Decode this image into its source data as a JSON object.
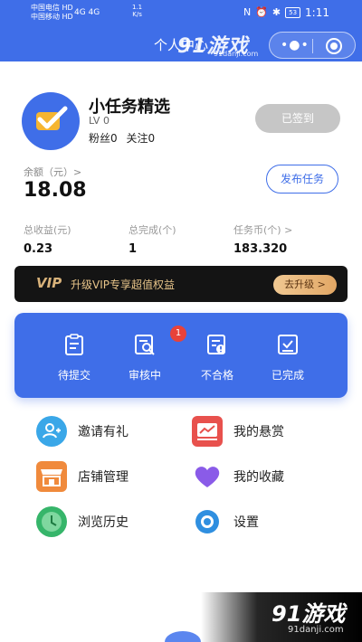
{
  "statusbar": {
    "carrier1": "中国电信 HD",
    "carrier2": "中国移动 HD",
    "signal": "4G 4G",
    "speed_value": "1.1",
    "speed_unit": "K/s",
    "battery": "53",
    "time": "1:11"
  },
  "navbar": {
    "title": "个人中心",
    "watermark": "91游戏",
    "watermark_url": "91danji.com"
  },
  "profile": {
    "username": "小任务精选",
    "level": "LV 0",
    "fans": "粉丝0",
    "following": "关注0",
    "checkin_label": "已签到",
    "balance_label": "余额（元）>",
    "balance_value": "18.08",
    "publish_label": "发布任务"
  },
  "stats": [
    {
      "label": "总收益(元)",
      "value": "0.23"
    },
    {
      "label": "总完成(个)",
      "value": "1"
    },
    {
      "label": "任务币(个) >",
      "value": "183.320"
    }
  ],
  "vip": {
    "badge": "VIP",
    "text": "升级VIP专享超值权益",
    "button": "去升级 >"
  },
  "orders": {
    "items": [
      {
        "label": "待提交",
        "icon": "clipboard-icon"
      },
      {
        "label": "审核中",
        "icon": "search-document-icon"
      },
      {
        "label": "不合格",
        "icon": "warning-document-icon"
      },
      {
        "label": "已完成",
        "icon": "check-document-icon"
      }
    ],
    "review_badge": "1"
  },
  "menu": [
    {
      "label": "邀请有礼",
      "icon": "invite-user-icon",
      "color": "#3aa7e8"
    },
    {
      "label": "我的悬赏",
      "icon": "reward-icon",
      "color": "#e8514d"
    },
    {
      "label": "店铺管理",
      "icon": "shop-icon",
      "color": "#f08a3c"
    },
    {
      "label": "我的收藏",
      "icon": "heart-icon",
      "color": "#8a5be8"
    },
    {
      "label": "浏览历史",
      "icon": "clock-icon",
      "color": "#36b56a"
    },
    {
      "label": "设置",
      "icon": "gear-icon",
      "color": "#2f8fe0"
    }
  ],
  "watermark_bottom": {
    "text": "91游戏",
    "url": "91danji.com"
  },
  "colors": {
    "primary": "#3f6ee8",
    "badge": "#e8423a",
    "vip_gold": "#e8c58a"
  }
}
